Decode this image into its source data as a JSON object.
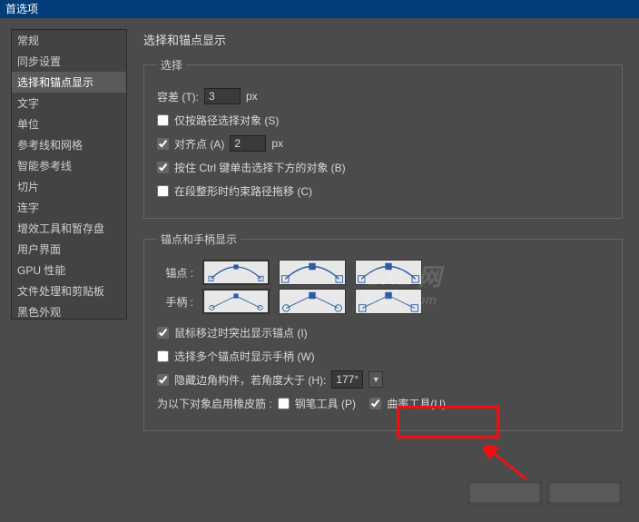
{
  "window": {
    "title": "首选项"
  },
  "sidebar": {
    "items": [
      {
        "label": "常规"
      },
      {
        "label": "同步设置"
      },
      {
        "label": "选择和锚点显示",
        "selected": true
      },
      {
        "label": "文字"
      },
      {
        "label": "单位"
      },
      {
        "label": "参考线和网格"
      },
      {
        "label": "智能参考线"
      },
      {
        "label": "切片"
      },
      {
        "label": "连字"
      },
      {
        "label": "增效工具和暂存盘"
      },
      {
        "label": "用户界面"
      },
      {
        "label": "GPU 性能"
      },
      {
        "label": "文件处理和剪贴板"
      },
      {
        "label": "黑色外观"
      }
    ]
  },
  "page": {
    "title": "选择和锚点显示"
  },
  "select": {
    "legend": "选择",
    "tolerance_label": "容差 (T):",
    "tolerance_value": "3",
    "px": "px",
    "path_only": "仅按路径选择对象 (S)",
    "snap_label": "对齐点 (A)",
    "snap_value": "2",
    "ctrl_click": "按住 Ctrl 键单击选择下方的对象 (B)",
    "constrain": "在段整形时约束路径拖移 (C)"
  },
  "anchor": {
    "legend": "锚点和手柄显示",
    "anchors_label": "锚点 :",
    "handles_label": "手柄 :",
    "highlight_hover": "鼠标移过时突出显示锚点 (I)",
    "show_handles_multi": "选择多个锚点时显示手柄 (W)",
    "hide_corner_label": "隐藏边角构件，若角度大于 (H):",
    "hide_corner_value": "177°",
    "rubberband_label": "为以下对象启用橡皮筋 :",
    "pen_tool": "钢笔工具 (P)",
    "curvature_tool": "曲率工具(U)"
  },
  "buttons": {
    "ok": "",
    "cancel": ""
  }
}
